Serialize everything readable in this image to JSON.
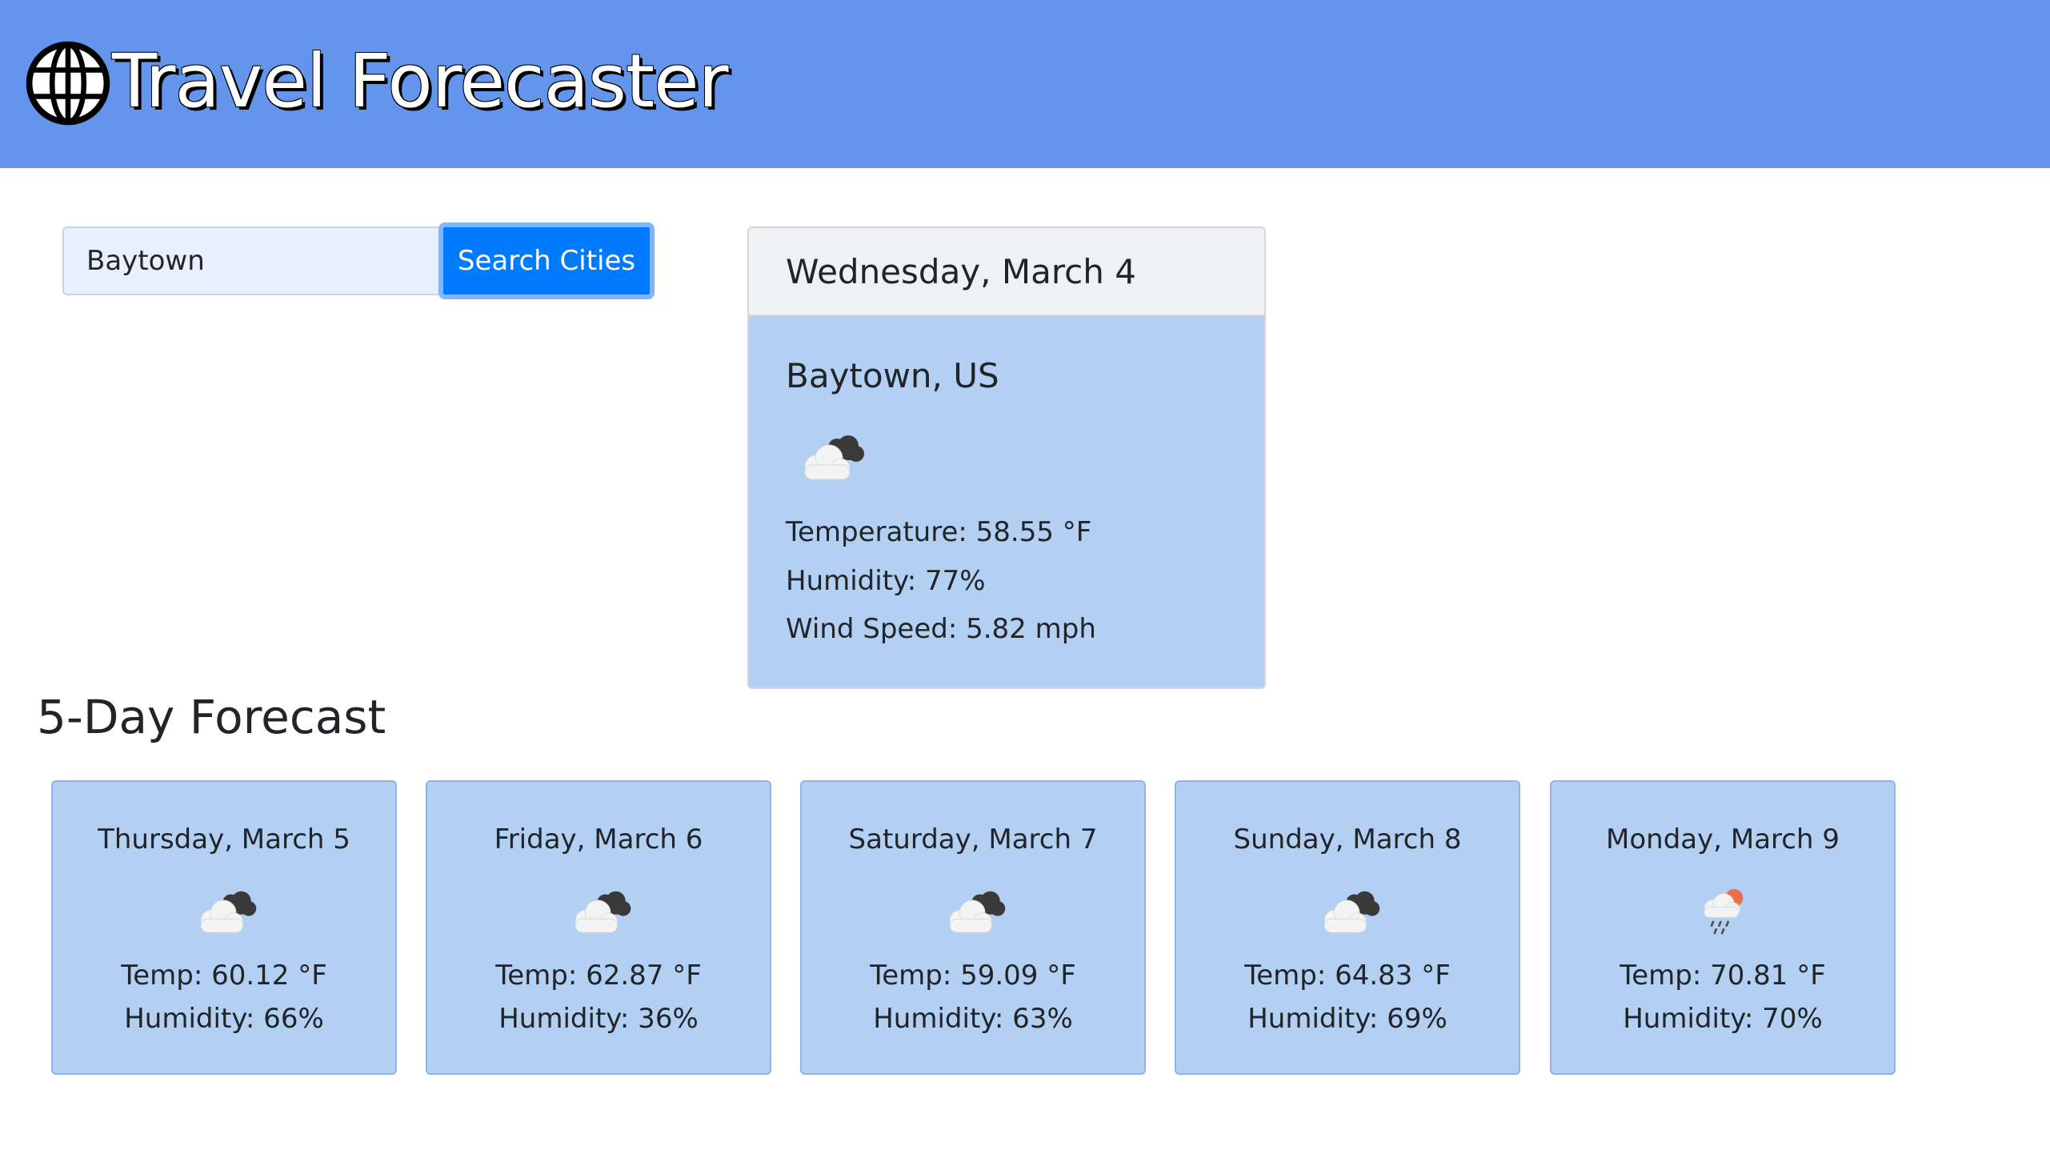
{
  "header": {
    "title": "Travel Forecaster",
    "logo_icon": "globe-icon",
    "background": "#6495ed"
  },
  "search": {
    "value": "Baytown",
    "button_label": "Search Cities",
    "button_color": "#007bff"
  },
  "current": {
    "date": "Wednesday, March 4",
    "city": "Baytown, US",
    "icon": "broken-clouds-icon",
    "temperature": "Temperature: 58.55 °F",
    "humidity": "Humidity: 77%",
    "wind": "Wind Speed: 5.82 mph"
  },
  "forecast": {
    "heading": "5-Day Forecast",
    "days": [
      {
        "date": "Thursday, March 5",
        "icon": "broken-clouds-icon",
        "temp": "Temp: 60.12 °F",
        "humidity": "Humidity: 66%"
      },
      {
        "date": "Friday, March 6",
        "icon": "broken-clouds-icon",
        "temp": "Temp: 62.87 °F",
        "humidity": "Humidity: 36%"
      },
      {
        "date": "Saturday, March 7",
        "icon": "broken-clouds-icon",
        "temp": "Temp: 59.09 °F",
        "humidity": "Humidity: 63%"
      },
      {
        "date": "Sunday, March 8",
        "icon": "broken-clouds-icon",
        "temp": "Temp: 64.83 °F",
        "humidity": "Humidity: 69%"
      },
      {
        "date": "Monday, March 9",
        "icon": "rain-icon",
        "temp": "Temp: 70.81 °F",
        "humidity": "Humidity: 70%"
      }
    ]
  },
  "colors": {
    "card_background": "#b3cff2",
    "card_header_background": "#f0f1f2"
  }
}
